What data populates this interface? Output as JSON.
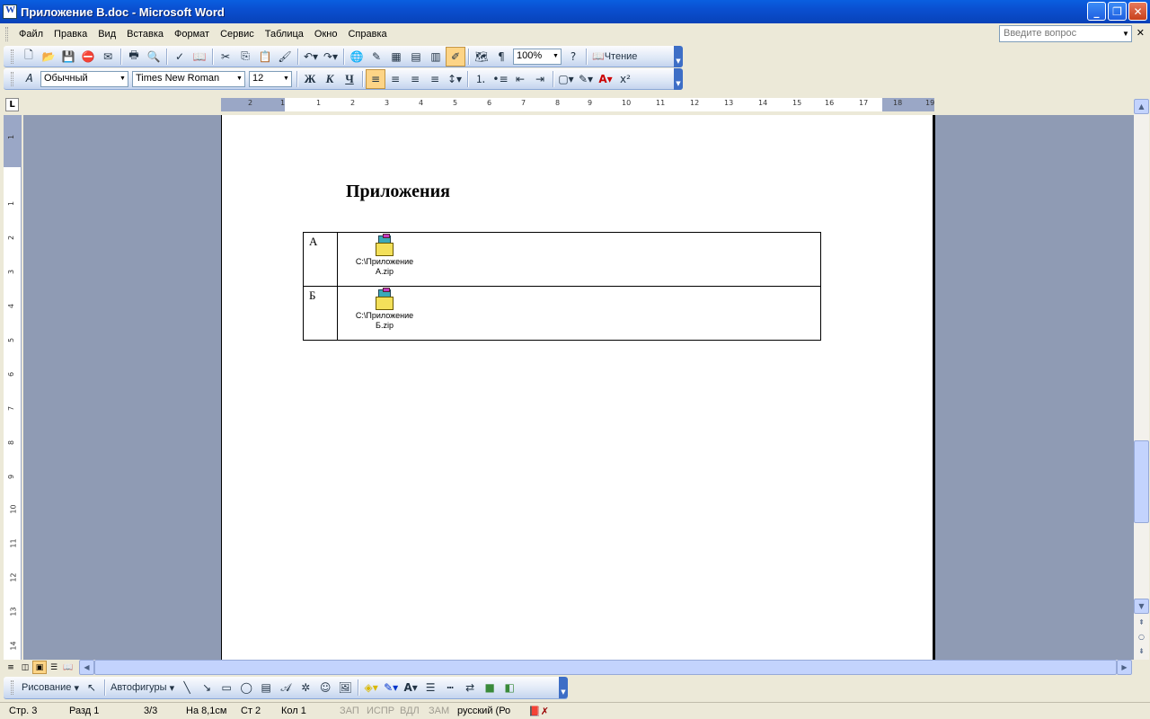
{
  "window": {
    "title": "Приложение В.doc - Microsoft Word"
  },
  "menu": {
    "items": [
      "Файл",
      "Правка",
      "Вид",
      "Вставка",
      "Формат",
      "Сервис",
      "Таблица",
      "Окно",
      "Справка"
    ],
    "ask_placeholder": "Введите вопрос"
  },
  "standard_toolbar": {
    "zoom": "100%",
    "reading_label": "Чтение"
  },
  "formatting_toolbar": {
    "style": "Обычный",
    "font": "Times New Roman",
    "size": "12",
    "bold": "Ж",
    "italic": "К",
    "underline": "Ч"
  },
  "ruler": {
    "h_ticks": [
      "2",
      "1",
      "1",
      "2",
      "3",
      "4",
      "5",
      "6",
      "7",
      "8",
      "9",
      "10",
      "11",
      "12",
      "13",
      "14",
      "15",
      "16",
      "17",
      "18",
      "19"
    ],
    "v_ticks": [
      "1",
      "1",
      "2",
      "3",
      "4",
      "5",
      "6",
      "7",
      "8",
      "9",
      "10",
      "11",
      "12",
      "13",
      "14"
    ]
  },
  "document": {
    "heading": "Приложения",
    "rows": [
      {
        "label": "А",
        "file_line1": "C:\\Приложение",
        "file_line2": "А.zip"
      },
      {
        "label": "Б",
        "file_line1": "C:\\Приложение",
        "file_line2": "Б.zip"
      }
    ]
  },
  "drawing_toolbar": {
    "draw_label": "Рисование",
    "autoshapes_label": "Автофигуры"
  },
  "status": {
    "page": "Стр. 3",
    "section": "Разд 1",
    "pages": "3/3",
    "at": "На 8,1см",
    "line": "Ст 2",
    "col": "Кол 1",
    "rec": "ЗАП",
    "trk": "ИСПР",
    "ext": "ВДЛ",
    "ovr": "ЗАМ",
    "language": "русский (Ро"
  }
}
